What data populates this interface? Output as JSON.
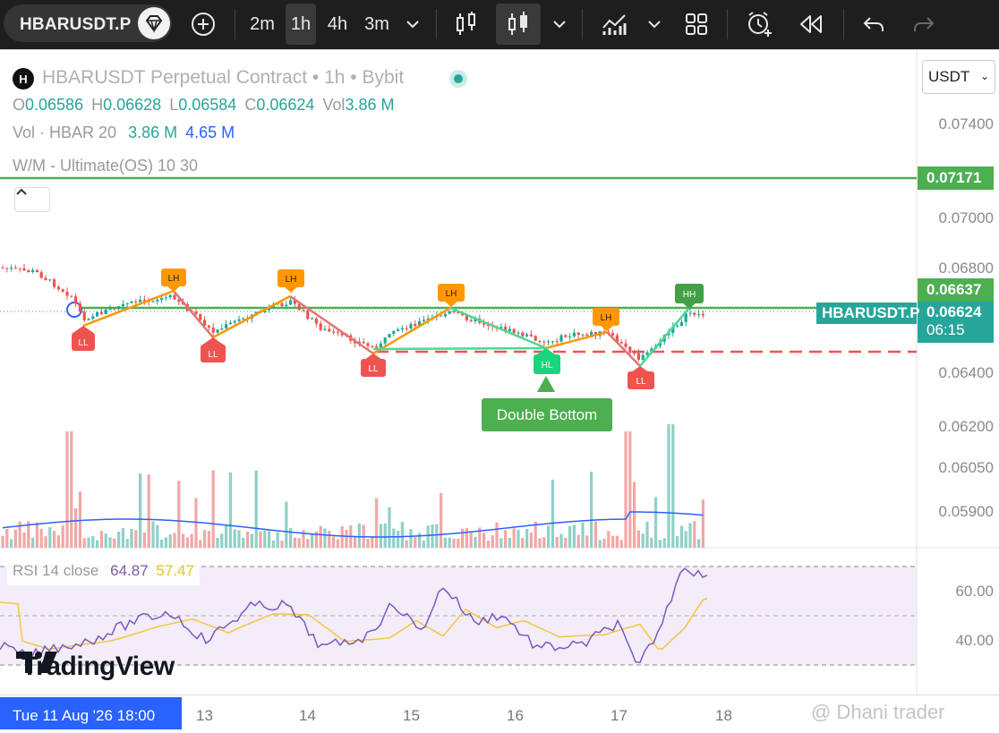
{
  "toolbar": {
    "symbol": "HBARUSDT.P",
    "intervals": [
      "2m",
      "1h",
      "4h",
      "3m"
    ],
    "active_interval": "1h"
  },
  "legend": {
    "title": "HBARUSDT Perpetual Contract",
    "interval": "1h",
    "exchange": "Bybit",
    "ohlc": {
      "o_label": "O",
      "o": "0.06586",
      "h_label": "H",
      "h": "0.06628",
      "l_label": "L",
      "l": "0.06584",
      "c_label": "C",
      "c": "0.06624",
      "vol_label": "Vol",
      "vol": "3.86 M"
    },
    "vol_indicator": {
      "label": "Vol · HBAR 20",
      "v1": "3.86 M",
      "v2": "4.65 M"
    },
    "wm_indicator": "W/M - Ultimate(OS) 10 30",
    "rsi": {
      "label": "RSI 14 close",
      "v1": "64.87",
      "v2": "57.47"
    }
  },
  "currency": "USDT",
  "price_axis": [
    "0.07400",
    "0.07000",
    "0.06800",
    "0.06400",
    "0.06200",
    "0.06050",
    "0.05900"
  ],
  "price_tags": {
    "green_line": "0.07171",
    "resistance": "0.06637",
    "last_price": "0.06624",
    "countdown": "06:15",
    "symbol_tag": "HBARUSDT.P"
  },
  "rsi_axis": [
    "60.00",
    "40.00"
  ],
  "pivot_labels": [
    "LL",
    "LH",
    "LL",
    "LH",
    "LL",
    "LH",
    "HL",
    "LH",
    "LL",
    "HH"
  ],
  "pattern_label": "Double Bottom",
  "logo": "TradingView",
  "time_axis": {
    "cursor": "Tue 11 Aug '26   18:00",
    "labels": [
      "13",
      "14",
      "15",
      "16",
      "17",
      "18"
    ]
  },
  "watermark": "@ Dhani trader",
  "colors": {
    "up": "#26a69a",
    "down": "#ef5350",
    "accent_green": "#4caf50",
    "orange": "#ff9800",
    "cursor_blue": "#2962ff"
  }
}
